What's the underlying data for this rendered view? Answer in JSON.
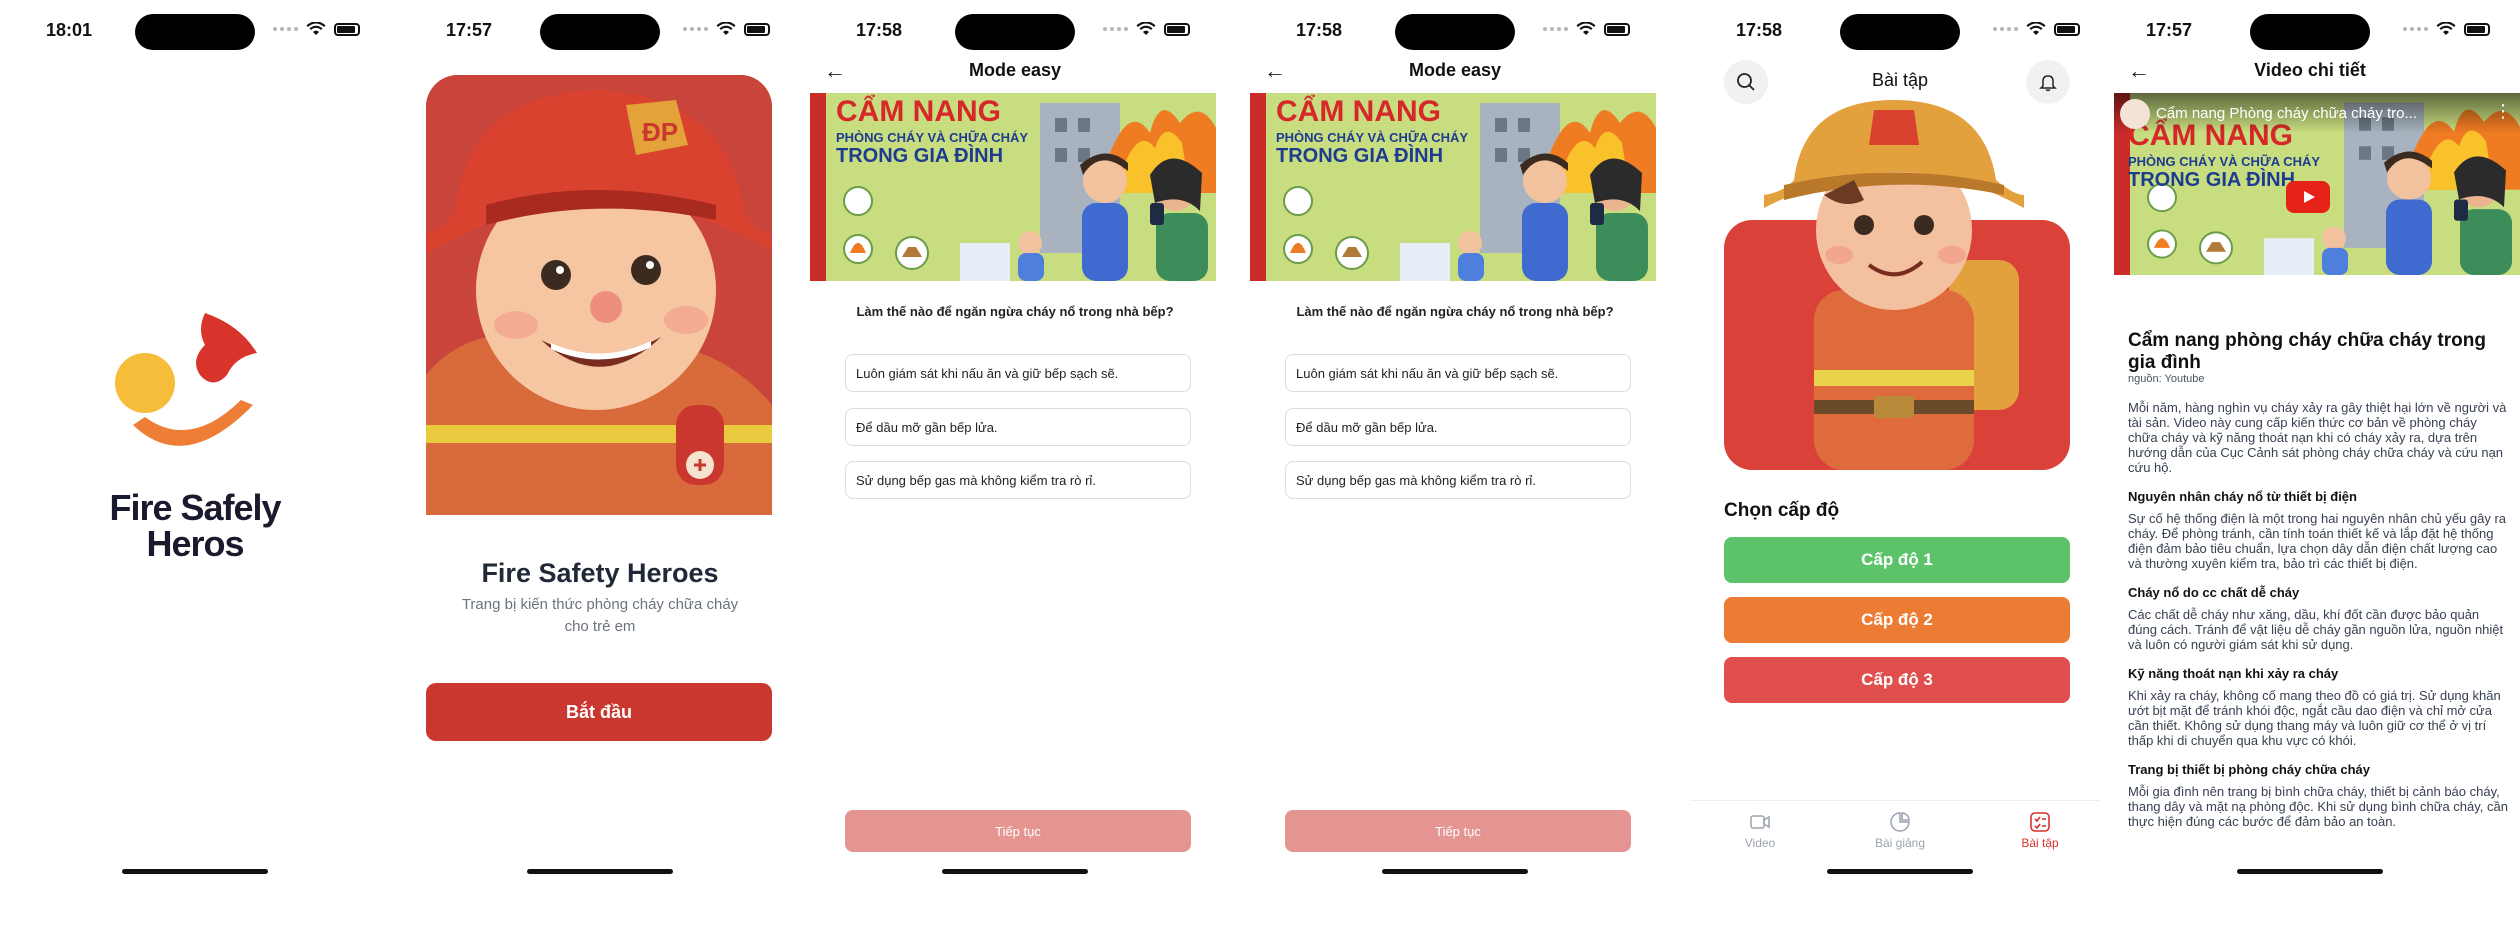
{
  "screens": {
    "splash": {
      "time": "18:01",
      "logo_title_line1": "Fire Safely",
      "logo_title_line2": "Heros",
      "colors": {
        "yellow": "#f5bd3a",
        "red": "#d9342b",
        "orange": "#ee7d36"
      }
    },
    "welcome": {
      "time": "17:57",
      "helmet_badge": "ĐP",
      "title": "Fire Safety Heroes",
      "subtitle": "Trang bị kiến thức phòng cháy chữa cháy cho trẻ em",
      "start_button": "Bắt đầu"
    },
    "quiz": {
      "time": "17:58",
      "title": "Mode easy",
      "banner_line1": "CẨM NANG",
      "banner_line2": "PHÒNG CHÁY VÀ CHỮA CHÁY",
      "banner_line3": "TRONG GIA ĐÌNH",
      "question": "Làm thế nào để ngăn ngừa cháy nổ trong nhà bếp?",
      "options": [
        "Luôn giám sát khi nấu ăn và giữ bếp sạch sẽ.",
        "Để dầu mỡ gần bếp lửa.",
        "Sử dụng bếp gas mà không kiểm tra rò rỉ."
      ],
      "continue_button": "Tiếp tục"
    },
    "levels": {
      "time": "17:58",
      "title": "Bài tập",
      "choose_level": "Chọn cấp độ",
      "levels": [
        "Cấp độ 1",
        "Cấp độ 2",
        "Cấp độ 3"
      ],
      "level_colors": [
        "#5dc36b",
        "#ec7b34",
        "#e14e4e"
      ],
      "tabs": [
        {
          "label": "Video",
          "icon": "video-icon"
        },
        {
          "label": "Bài giảng",
          "icon": "lecture-icon"
        },
        {
          "label": "Bài tập",
          "icon": "exercise-icon"
        }
      ],
      "active_tab": "Bài tập"
    },
    "video_detail": {
      "time": "17:57",
      "title": "Video chi tiết",
      "video_overlay_title": "Cẩm nang Phòng cháy chữa cháy tro...",
      "video_title": "Cẩm nang phòng cháy chữa cháy trong gia đình",
      "source": "nguồn: Youtube",
      "intro": "Mỗi năm, hàng nghìn vụ cháy xảy ra gây thiệt hại lớn về người và tài sản. Video này cung cấp kiến thức cơ bản về phòng cháy chữa cháy và kỹ năng thoát nạn khi có cháy xảy ra, dựa trên hướng dẫn của Cục Cảnh sát phòng cháy chữa cháy và cứu nạn cứu hộ.",
      "sections": [
        {
          "heading": "Nguyên nhân cháy nổ từ thiết bị điện",
          "text": "Sự cố hệ thống điện là một trong hai nguyên nhân chủ yếu gây ra cháy. Để phòng tránh, cần tính toán thiết kế và lắp đặt hệ thống điện đảm bảo tiêu chuẩn, lựa chọn dây dẫn điện chất lượng cao và thường xuyên kiểm tra, bảo trì các thiết bị điện."
        },
        {
          "heading": "Cháy nổ do cc chất dễ cháy",
          "text": "Các chất dễ cháy như xăng, dầu, khí đốt cần được bảo quản đúng cách. Tránh để vật liệu dễ cháy gần nguồn lửa, nguồn nhiệt và luôn có người giám sát khi sử dụng."
        },
        {
          "heading": "Kỹ năng thoát nạn khi xảy ra cháy",
          "text": "Khi xảy ra cháy, không cố mang theo đồ có giá trị. Sử dụng khăn ướt bịt mặt để tránh khói độc, ngắt cầu dao điện và chỉ mở cửa cần thiết. Không sử dụng thang máy và luôn giữ cơ thể ở vị trí thấp khi di chuyển qua khu vực có khói."
        },
        {
          "heading": "Trang bị thiết bị phòng cháy chữa cháy",
          "text": "Mỗi gia đình nên trang bị bình chữa cháy, thiết bị cảnh báo cháy, thang dây và mặt nạ phòng độc. Khi sử dụng bình chữa cháy, cần thực hiện đúng các bước để đảm bảo an toàn."
        }
      ]
    }
  }
}
